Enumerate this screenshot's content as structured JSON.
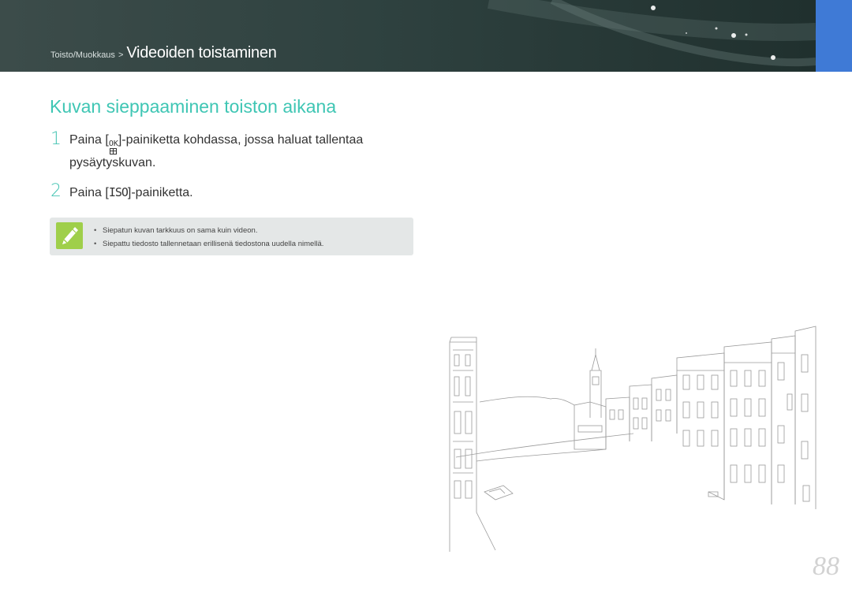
{
  "header": {
    "breadcrumb_parent": "Toisto/Muokkaus",
    "breadcrumb_separator": ">",
    "breadcrumb_current": "Videoiden toistaminen",
    "background_color": "#33403e",
    "tab_color": "#3f7ad6"
  },
  "title": "Kuvan sieppaaminen toiston aikana",
  "steps": [
    {
      "number": "1",
      "prefix": "Paina [",
      "button_icon": "ok-button-icon",
      "button_top": "OK",
      "suffix": "]-painiketta kohdassa, jossa haluat tallentaa pysäytyskuvan."
    },
    {
      "number": "2",
      "prefix": "Paina [",
      "button_label": "ISO",
      "suffix": "]-painiketta."
    }
  ],
  "note": {
    "icon": "pen-note-icon",
    "items": [
      "Siepatun kuvan tarkkuus on sama kuin videon.",
      "Siepattu tiedosto tallennetaan erillisenä tiedostona uudella nimellä."
    ]
  },
  "page_number": "88",
  "colors": {
    "accent": "#3fc6b4",
    "note_background": "#e4e7e7",
    "note_icon": "#9fcf4a"
  }
}
